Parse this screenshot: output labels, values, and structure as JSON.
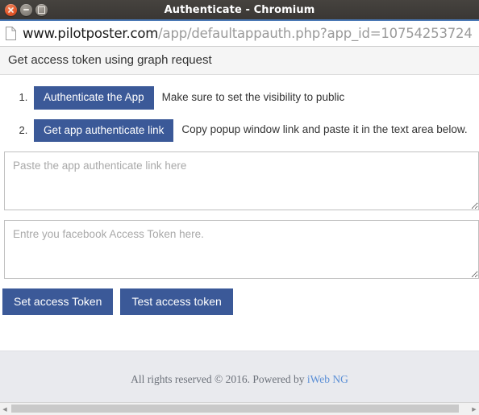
{
  "window": {
    "title": "Authenticate - Chromium",
    "controls": {
      "close_label": "×",
      "minimize_label": "",
      "maximize_label": ""
    }
  },
  "omnibox": {
    "icon": "page-icon",
    "url_host": "www.pilotposter.com",
    "url_path": "/app/defaultappauth.php?app_id=10754253724"
  },
  "panel": {
    "heading": "Get access token using graph request"
  },
  "steps": [
    {
      "number": "1.",
      "button_label": "Authenticate the App",
      "note": "Make sure to set the visibility to public"
    },
    {
      "number": "2.",
      "button_label": "Get app authenticate link",
      "note": "Copy popup window link and paste it in the text area below."
    }
  ],
  "inputs": {
    "auth_link": {
      "placeholder": "Paste the app authenticate link here",
      "value": ""
    },
    "access_token": {
      "placeholder": "Entre you facebook Access Token here.",
      "value": ""
    }
  },
  "actions": {
    "set_token_label": "Set access Token",
    "test_token_label": "Test access token"
  },
  "footer": {
    "text": "All rights reserved © 2016. Powered by ",
    "link_label": "iWeb NG"
  },
  "scrollbar": {
    "left_arrow": "◀",
    "right_arrow": "▶"
  },
  "colors": {
    "accent": "#3b5998",
    "titlebar": "#3a3734",
    "close_button": "#e2572a",
    "footer_bg": "#e9eaee",
    "link": "#5b8fd6"
  }
}
